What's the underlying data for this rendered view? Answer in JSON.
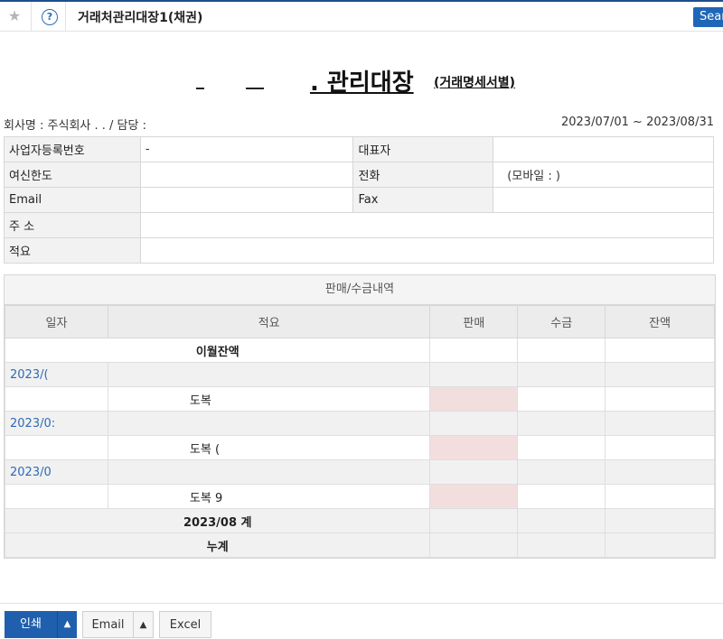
{
  "topbar": {
    "title": "거래처관리대장1(채권)",
    "help_glyph": "?",
    "search_label": "Sear"
  },
  "heading": {
    "main": ". 관리대장",
    "sub": "(거래명세서별)"
  },
  "company_line": "회사명 : 주식회사  . . / 담당 :",
  "period": "2023/07/01 ~ 2023/08/31",
  "info": {
    "biz_no_label": "사업자등록번호",
    "biz_no_value": "-",
    "rep_label": "대표자",
    "rep_value": "",
    "credit_label": "여신한도",
    "credit_value": "",
    "phone_label": "전화",
    "phone_value": "(모바일 : )",
    "email_label": "Email",
    "email_value": "",
    "fax_label": "Fax",
    "fax_value": "",
    "address_label": "주 소",
    "address_value": "",
    "memo_label": "적요",
    "memo_value": ""
  },
  "ledger": {
    "caption": "판매/수금내역",
    "headers": [
      "일자",
      "적요",
      "판매",
      "수금",
      "잔액"
    ],
    "carry_over": "이월잔액",
    "rows": [
      {
        "date": "2023/(",
        "desc": ""
      },
      {
        "date": "",
        "desc": "도복"
      },
      {
        "date": "2023/0:",
        "desc": ""
      },
      {
        "date": "",
        "desc": "도복 ("
      },
      {
        "date": "2023/0",
        "desc": ""
      },
      {
        "date": "",
        "desc": "도복 9"
      }
    ],
    "month_total": "2023/08 계",
    "cumulative": "누계"
  },
  "buttons": {
    "print": "인쇄",
    "email": "Email",
    "excel": "Excel",
    "arrow": "▲"
  },
  "colors": {
    "accent": "#1f5fae",
    "date_link": "#2d6bb5",
    "sale_cell": "#f3dede"
  }
}
